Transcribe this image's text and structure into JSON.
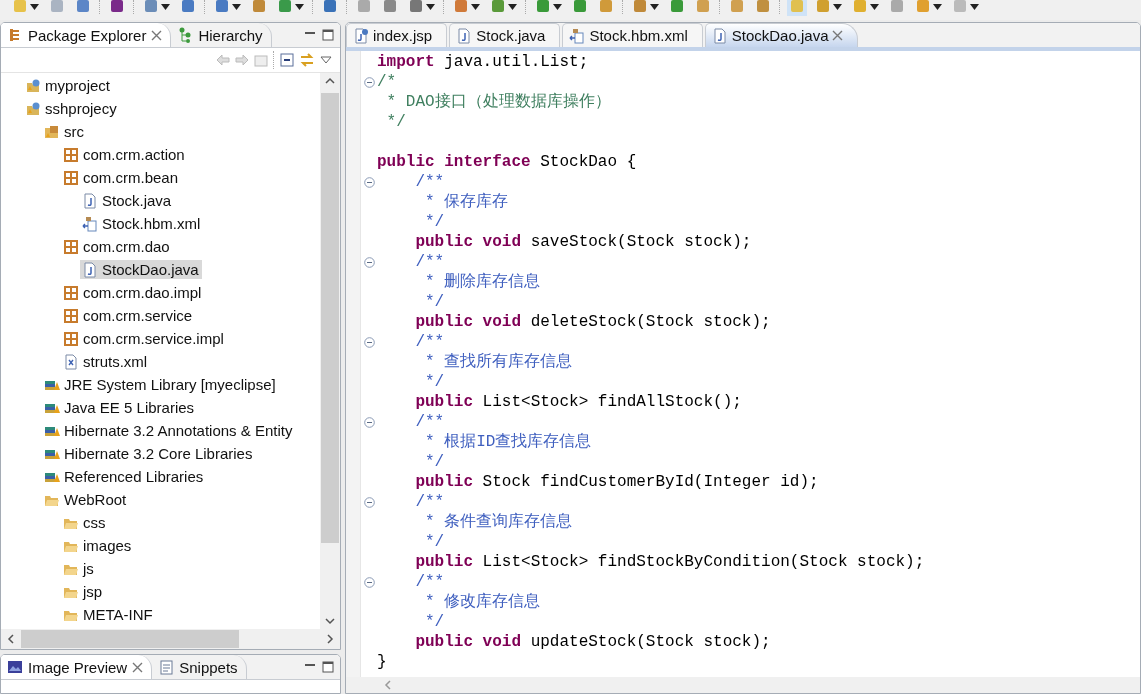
{
  "explorer": {
    "tabs": [
      {
        "label": "Package Explorer",
        "kind": "packages",
        "selected": true
      },
      {
        "label": "Hierarchy",
        "kind": "hierarchy",
        "selected": false
      }
    ],
    "tree": [
      {
        "label": "myproject",
        "kind": "project",
        "selected": false
      },
      {
        "label": "sshprojecy",
        "kind": "project",
        "selected": false,
        "children": [
          {
            "label": "src",
            "kind": "source-folder",
            "selected": false,
            "children": [
              {
                "label": "com.crm.action",
                "kind": "package",
                "selected": false
              },
              {
                "label": "com.crm.bean",
                "kind": "package",
                "selected": false,
                "children": [
                  {
                    "label": "Stock.java",
                    "kind": "java-file",
                    "selected": false
                  },
                  {
                    "label": "Stock.hbm.xml",
                    "kind": "hbm-file",
                    "selected": false
                  }
                ]
              },
              {
                "label": "com.crm.dao",
                "kind": "package",
                "selected": false,
                "children": [
                  {
                    "label": "StockDao.java",
                    "kind": "java-file",
                    "selected": true
                  }
                ]
              },
              {
                "label": "com.crm.dao.impl",
                "kind": "package",
                "selected": false
              },
              {
                "label": "com.crm.service",
                "kind": "package",
                "selected": false
              },
              {
                "label": "com.crm.service.impl",
                "kind": "package",
                "selected": false
              },
              {
                "label": "struts.xml",
                "kind": "xml-file",
                "selected": false
              }
            ]
          },
          {
            "label": "JRE System Library [myeclipse]",
            "kind": "library",
            "selected": false
          },
          {
            "label": "Java EE 5 Libraries",
            "kind": "library",
            "selected": false
          },
          {
            "label": "Hibernate 3.2 Annotations & Entity",
            "kind": "library",
            "selected": false
          },
          {
            "label": "Hibernate 3.2 Core Libraries",
            "kind": "library",
            "selected": false
          },
          {
            "label": "Referenced Libraries",
            "kind": "library",
            "selected": false
          },
          {
            "label": "WebRoot",
            "kind": "folder",
            "selected": false,
            "children": [
              {
                "label": "css",
                "kind": "folder",
                "selected": false
              },
              {
                "label": "images",
                "kind": "folder",
                "selected": false
              },
              {
                "label": "js",
                "kind": "folder",
                "selected": false
              },
              {
                "label": "jsp",
                "kind": "folder",
                "selected": false
              },
              {
                "label": "META-INF",
                "kind": "folder",
                "selected": false
              }
            ]
          }
        ]
      }
    ]
  },
  "bottom_panel": {
    "tabs": [
      {
        "label": "Image Preview",
        "kind": "image",
        "selected": true
      },
      {
        "label": "Snippets",
        "kind": "snippets",
        "selected": false
      }
    ]
  },
  "editor": {
    "tabs": [
      {
        "label": "index.jsp",
        "kind": "jsp",
        "selected": false
      },
      {
        "label": "Stock.java",
        "kind": "java",
        "selected": false
      },
      {
        "label": "Stock.hbm.xml",
        "kind": "hbm",
        "selected": false
      },
      {
        "label": "StockDao.java",
        "kind": "java",
        "selected": true
      }
    ],
    "lines": [
      {
        "fold": false,
        "tokens": [
          {
            "kind": "keyword",
            "text": "import"
          },
          {
            "kind": "plain",
            "text": " java.util.List;"
          }
        ]
      },
      {
        "fold": true,
        "tokens": [
          {
            "kind": "comment",
            "text": "/*"
          }
        ]
      },
      {
        "fold": false,
        "tokens": [
          {
            "kind": "comment",
            "text": " * DAO接口（处理数据库操作）"
          }
        ]
      },
      {
        "fold": false,
        "tokens": [
          {
            "kind": "comment",
            "text": " */"
          }
        ]
      },
      {
        "fold": false
      },
      {
        "fold": false,
        "tokens": [
          {
            "kind": "keyword",
            "text": "public interface"
          },
          {
            "kind": "plain",
            "text": " StockDao {"
          }
        ]
      },
      {
        "fold": true,
        "tokens": [
          {
            "kind": "javadoc",
            "text": "    /**"
          }
        ]
      },
      {
        "fold": false,
        "tokens": [
          {
            "kind": "javadoc",
            "text": "     * 保存库存"
          }
        ]
      },
      {
        "fold": false,
        "tokens": [
          {
            "kind": "javadoc",
            "text": "     */"
          }
        ]
      },
      {
        "fold": false,
        "tokens": [
          {
            "kind": "keyword",
            "text": "    public void"
          },
          {
            "kind": "plain",
            "text": " saveStock(Stock stock);"
          }
        ]
      },
      {
        "fold": true,
        "tokens": [
          {
            "kind": "javadoc",
            "text": "    /**"
          }
        ]
      },
      {
        "fold": false,
        "tokens": [
          {
            "kind": "javadoc",
            "text": "     * 删除库存信息"
          }
        ]
      },
      {
        "fold": false,
        "tokens": [
          {
            "kind": "javadoc",
            "text": "     */"
          }
        ]
      },
      {
        "fold": false,
        "tokens": [
          {
            "kind": "keyword",
            "text": "    public void"
          },
          {
            "kind": "plain",
            "text": " deleteStock(Stock stock);"
          }
        ]
      },
      {
        "fold": true,
        "tokens": [
          {
            "kind": "javadoc",
            "text": "    /**"
          }
        ]
      },
      {
        "fold": false,
        "tokens": [
          {
            "kind": "javadoc",
            "text": "     * 查找所有库存信息"
          }
        ]
      },
      {
        "fold": false,
        "tokens": [
          {
            "kind": "javadoc",
            "text": "     */"
          }
        ]
      },
      {
        "fold": false,
        "tokens": [
          {
            "kind": "keyword",
            "text": "    public"
          },
          {
            "kind": "plain",
            "text": " List<Stock> findAllStock();"
          }
        ]
      },
      {
        "fold": true,
        "tokens": [
          {
            "kind": "javadoc",
            "text": "    /**"
          }
        ]
      },
      {
        "fold": false,
        "tokens": [
          {
            "kind": "javadoc",
            "text": "     * 根据ID查找库存信息"
          }
        ]
      },
      {
        "fold": false,
        "tokens": [
          {
            "kind": "javadoc",
            "text": "     */"
          }
        ]
      },
      {
        "fold": false,
        "tokens": [
          {
            "kind": "keyword",
            "text": "    public"
          },
          {
            "kind": "plain",
            "text": " Stock findCustomerById(Integer id);"
          }
        ]
      },
      {
        "fold": true,
        "tokens": [
          {
            "kind": "javadoc",
            "text": "    /**"
          }
        ]
      },
      {
        "fold": false,
        "tokens": [
          {
            "kind": "javadoc",
            "text": "     * 条件查询库存信息"
          }
        ]
      },
      {
        "fold": false,
        "tokens": [
          {
            "kind": "javadoc",
            "text": "     */"
          }
        ]
      },
      {
        "fold": false,
        "tokens": [
          {
            "kind": "keyword",
            "text": "    public"
          },
          {
            "kind": "plain",
            "text": " List<Stock> findStockByCondition(Stock stock);"
          }
        ]
      },
      {
        "fold": true,
        "tokens": [
          {
            "kind": "javadoc",
            "text": "    /**"
          }
        ]
      },
      {
        "fold": false,
        "tokens": [
          {
            "kind": "javadoc",
            "text": "     * 修改库存信息"
          }
        ]
      },
      {
        "fold": false,
        "tokens": [
          {
            "kind": "javadoc",
            "text": "     */"
          }
        ]
      },
      {
        "fold": false,
        "tokens": [
          {
            "kind": "keyword",
            "text": "    public void"
          },
          {
            "kind": "plain",
            "text": " updateStock(Stock stock);"
          }
        ]
      },
      {
        "fold": false,
        "tokens": [
          {
            "kind": "plain",
            "text": "}"
          }
        ]
      }
    ]
  }
}
